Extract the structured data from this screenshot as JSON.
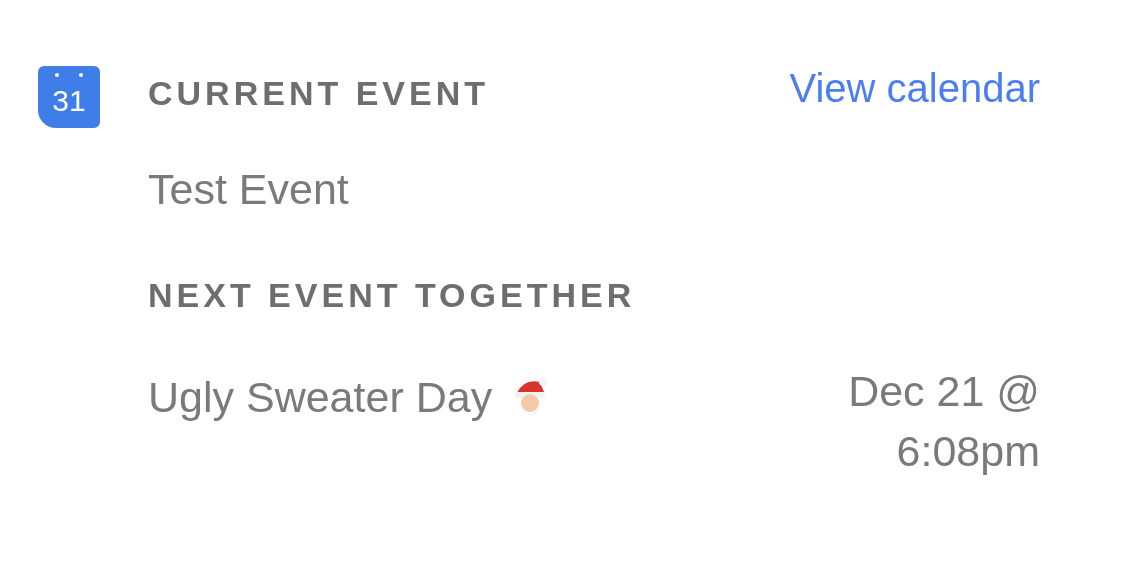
{
  "current_event": {
    "icon_text": "31",
    "heading": "CURRENT EVENT",
    "link": "View calendar",
    "name": "Test Event"
  },
  "next_event": {
    "heading": "NEXT EVENT TOGETHER",
    "name": "Ugly Sweater Day",
    "when": "Dec 21 @ 6:08pm"
  }
}
